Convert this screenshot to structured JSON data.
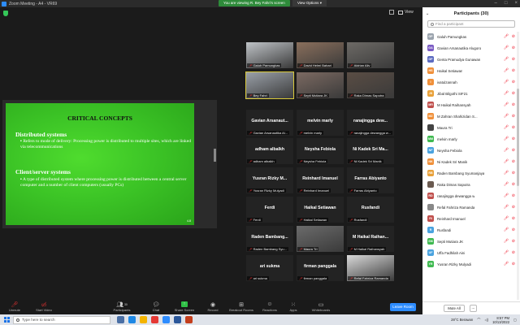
{
  "window": {
    "title": "Zoom Meeting - A4 - VR69",
    "viewing_banner": "You are viewing R. Bey Fahri's screen",
    "view_options": "View Options"
  },
  "meeting": {
    "view_label": "View"
  },
  "slide": {
    "title": "CRITICAL CONCEPTS",
    "section1_heading": "Distributed systems",
    "section1_body": "Refers to mode of delivery: Processing power is distributed to multiple sites, which are linked via telecommunications",
    "section2_heading": "Client/server systems",
    "section2_body": "A type of distributed system where processing power is distributed between a central server computer and a number of client computers (usually PCs)",
    "page": "4-8"
  },
  "tiles": [
    {
      "big": "",
      "label": "Galuh Pamungkas",
      "video": true,
      "color": "#bfc3c7"
    },
    {
      "big": "",
      "label": "David Helmi Bahari",
      "video": true,
      "color": "#8a6f5c"
    },
    {
      "big": "",
      "label": "Aldrian Aliv",
      "video": true,
      "color": "#6d6a66"
    },
    {
      "big": "",
      "label": "Bey Fahri",
      "video": true,
      "color": "#9aa0a8",
      "active": true
    },
    {
      "big": "",
      "label": "Septi Mutiara JK",
      "video": true,
      "color": "#7c6a62"
    },
    {
      "big": "",
      "label": "Raka Dimas Saputra",
      "video": true,
      "color": "#5a4d44"
    },
    {
      "big": "Gavian Arsanaut...",
      "label": "Gavian Arsanautika Al..."
    },
    {
      "big": "melvin marly",
      "label": "melvin marly"
    },
    {
      "big": "ranajingga dew...",
      "label": "ranajingga dewangga w..."
    },
    {
      "big": "adham albalkh",
      "label": "adham albalkh"
    },
    {
      "big": "Neysha Febiola",
      "label": "Neysha Febiola"
    },
    {
      "big": "Ni Kadek Sri Ma...",
      "label": "Ni Kadek Sri Manik"
    },
    {
      "big": "Yusran Rizky M...",
      "label": "Yusran Rizky Mulyadi"
    },
    {
      "big": "Reinhard Imanuel",
      "label": "Reinhard Imanuel"
    },
    {
      "big": "Farras Abiyanto",
      "label": "Farras Abiyanto"
    },
    {
      "big": "Ferdi",
      "label": "Ferdi"
    },
    {
      "big": "Haikal Setiawan",
      "label": "Haikal Setiawan"
    },
    {
      "big": "Rusfandi",
      "label": "Rusfandi"
    },
    {
      "big": "Raden Bambang...",
      "label": "Raden Bambang Syu..."
    },
    {
      "big": "",
      "label": "Maura Tri",
      "video": true,
      "color": "#6b6b6b"
    },
    {
      "big": "M Haikal Raihan...",
      "label": "M Haikal Raihansyah"
    },
    {
      "big": "ari sukma",
      "label": "ari sukma"
    },
    {
      "big": "firman panggala",
      "label": "firman panggala"
    },
    {
      "big": "",
      "label": "Refal Fahriza Ramanda",
      "video": true,
      "color": "#d9d9d9"
    }
  ],
  "toolbar": {
    "unmute": "Unmute",
    "start_video": "Start Video",
    "participants": "Participants",
    "participants_count": "30",
    "chat": "Chat",
    "share_screen": "Share Screen",
    "record": "Record",
    "breakout_rooms": "Breakout Rooms",
    "reactions": "Reactions",
    "apps": "Apps",
    "whiteboards": "Whiteboards",
    "leave": "Leave Room"
  },
  "panel": {
    "title": "Participants (30)",
    "search_placeholder": "Find a participant",
    "mute_all": "Mute All",
    "more": "...",
    "participants": [
      {
        "initials": "GP",
        "name": "Galuh Pamungkas",
        "color": "#9aa3ad"
      },
      {
        "initials": "GA",
        "name": "Gavian Arsanautika Alugoro",
        "color": "#7b5cc4"
      },
      {
        "initials": "GP",
        "name": "Genta Pramudya Gunawan",
        "color": "#5c6bc0"
      },
      {
        "initials": "HS",
        "name": "Haikal Setiawan",
        "color": "#f0903a"
      },
      {
        "initials": "I",
        "name": "ivatulzannah",
        "color": "#f0903a"
      },
      {
        "initials": "JS",
        "name": "Jibal Bilgothi SIF21",
        "color": "#e8a13a"
      },
      {
        "initials": "MR",
        "name": "M Haikal Raihansyah",
        "color": "#c0504d"
      },
      {
        "initials": "MZ",
        "name": "M Zahran Shahizidan S...",
        "color": "#f0903a"
      },
      {
        "initials": "",
        "name": "Maura Tri",
        "color": "#444444"
      },
      {
        "initials": "MM",
        "name": "melvin marly",
        "color": "#3fb950"
      },
      {
        "initials": "NF",
        "name": "Neysha Febiola",
        "color": "#4aa3df"
      },
      {
        "initials": "NK",
        "name": "Ni Kadek Sri Manik",
        "color": "#f0903a"
      },
      {
        "initials": "RB",
        "name": "Raden Bambang Syumanjaya",
        "color": "#e8a13a"
      },
      {
        "initials": "",
        "name": "Raka Dimas Saputra",
        "color": "#6a5a50"
      },
      {
        "initials": "RD",
        "name": "ranajingga dewangga w",
        "color": "#c0504d"
      },
      {
        "initials": "",
        "name": "Refal Fahriza Ramanda",
        "color": "#888888"
      },
      {
        "initials": "RI",
        "name": "Reinhard Imanuel",
        "color": "#c0504d"
      },
      {
        "initials": "R",
        "name": "Rusfandi",
        "color": "#4aa3df"
      },
      {
        "initials": "SM",
        "name": "Septi Mutiara JK",
        "color": "#3fb950"
      },
      {
        "initials": "UF",
        "name": "Uffa Fadhilah Aini",
        "color": "#4aa3df"
      },
      {
        "initials": "YR",
        "name": "Yusran Rizky Mulyadi",
        "color": "#3fb950"
      }
    ]
  },
  "taskbar": {
    "search_placeholder": "Type here to search",
    "weather": "28°C Berawan",
    "time": "8:57 PM",
    "date": "10/13/2022"
  }
}
